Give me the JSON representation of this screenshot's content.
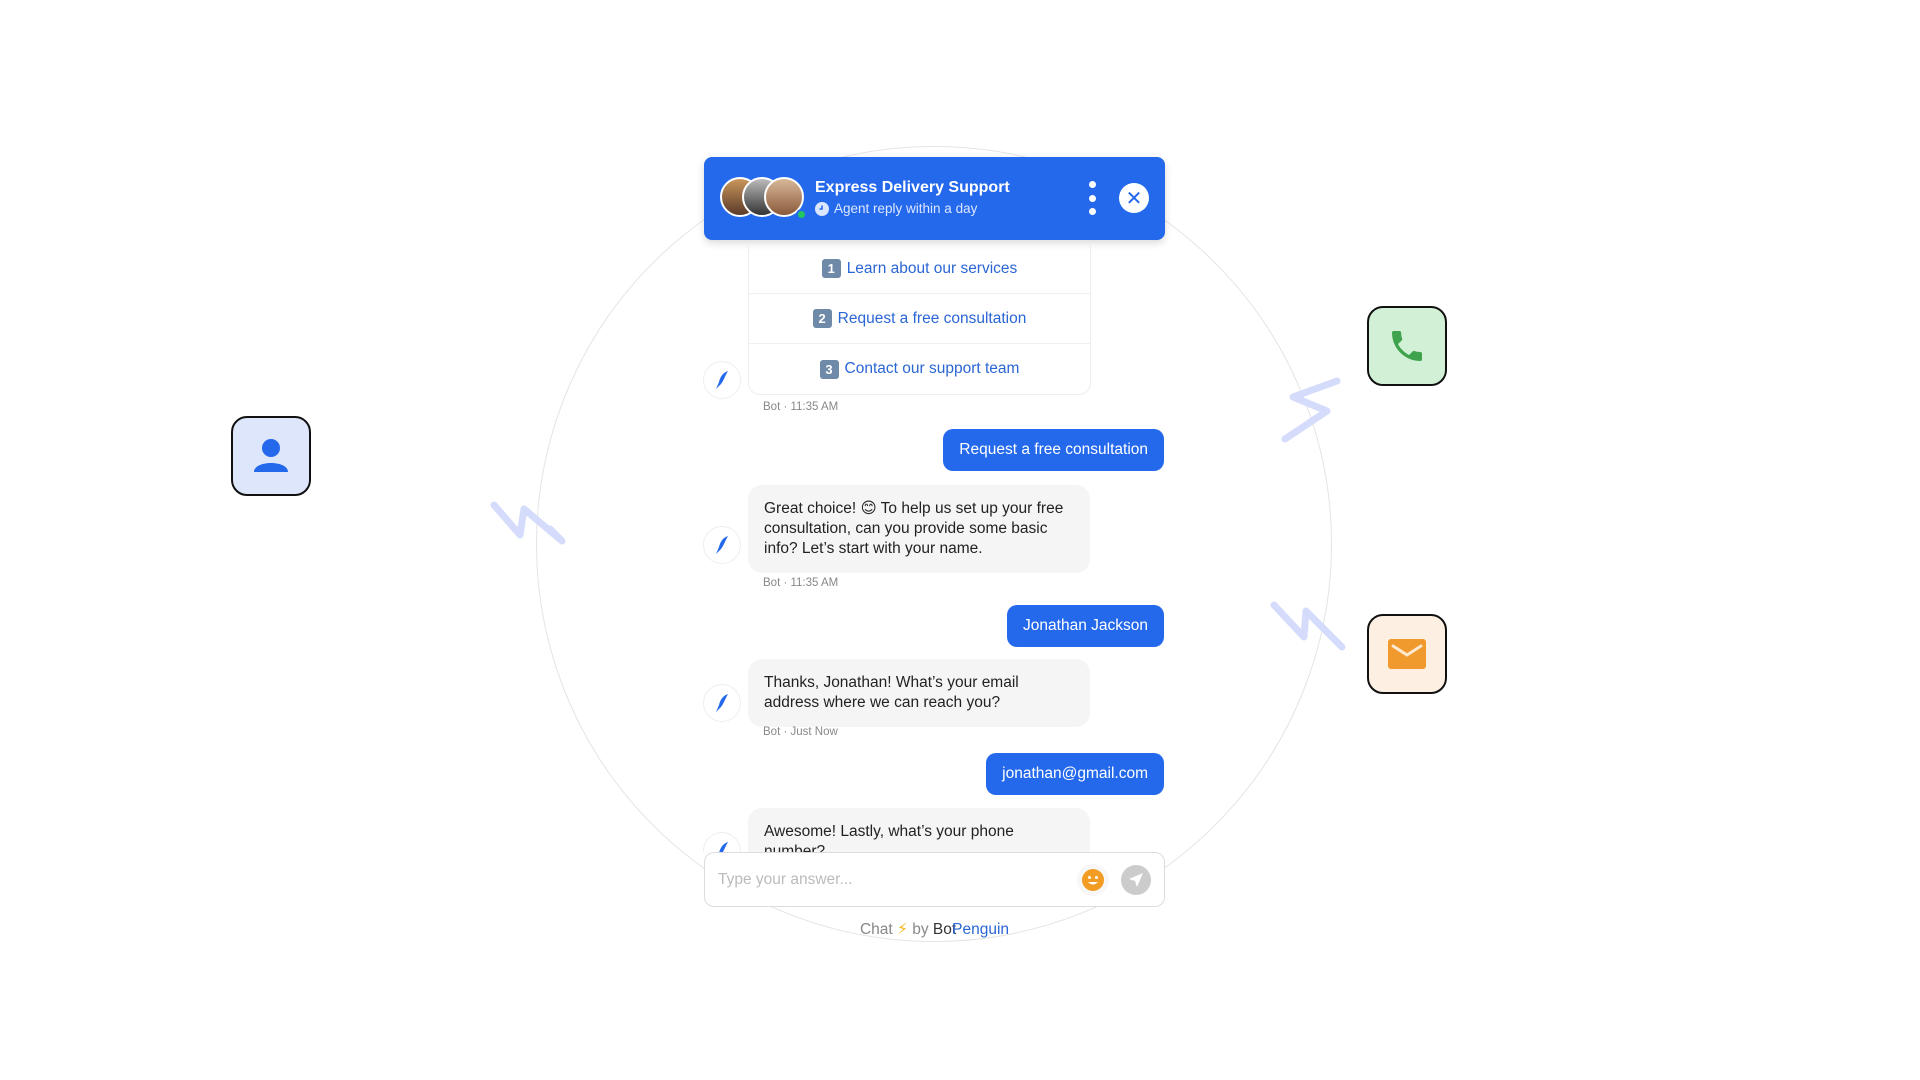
{
  "header": {
    "title": "Express Delivery Support",
    "subtitle": "Agent reply within a day",
    "online_color": "#22c55e"
  },
  "options": [
    {
      "num": "1",
      "label": "Learn about our services"
    },
    {
      "num": "2",
      "label": "Request a free consultation"
    },
    {
      "num": "3",
      "label": "Contact our support team"
    }
  ],
  "messages": [
    {
      "from": "bot",
      "timestamp": "Bot · 11:35 AM"
    },
    {
      "from": "user",
      "text": "Request a free consultation"
    },
    {
      "from": "bot",
      "text": "Great choice! 😊 To help us set up your free consultation, can you provide some basic info? Let’s start with your name.",
      "timestamp": "Bot · 11:35 AM"
    },
    {
      "from": "user",
      "text": "Jonathan Jackson"
    },
    {
      "from": "bot",
      "text": "Thanks, Jonathan! What’s your email address where we can reach you?",
      "timestamp": "Bot · Just Now"
    },
    {
      "from": "user",
      "text": "jonathan@gmail.com"
    },
    {
      "from": "bot",
      "text": "Awesome! Lastly, what’s your phone number?"
    }
  ],
  "input": {
    "placeholder": "Type your answer..."
  },
  "footer": {
    "prefix": "Chat",
    "by": "by",
    "brand_a": "Bot",
    "brand_b": "Penguin"
  },
  "colors": {
    "primary": "#2469ec",
    "phone_bg": "#d2f0d6",
    "mail_bg": "#fdf0e2",
    "person_bg": "#dde6fb"
  },
  "side_icons": [
    "person-icon",
    "phone-icon",
    "mail-icon"
  ]
}
